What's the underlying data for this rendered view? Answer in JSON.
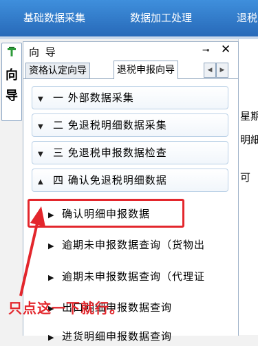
{
  "menubar": {
    "items": [
      "基础数据采集",
      "数据加工处理",
      "退税"
    ]
  },
  "vertical_tab": {
    "label_line1": "向",
    "label_line2": "导"
  },
  "panel": {
    "title": "向 导",
    "pin": "⊸",
    "close": "✕",
    "tabs": [
      "资格认定向导",
      "退税申报向导"
    ],
    "active_tab": "退税申报向导",
    "sections": [
      {
        "label": "一 外部数据采集",
        "chevron": "▼"
      },
      {
        "label": "二 免退税明细数据采集",
        "chevron": "▼"
      },
      {
        "label": "三 免退税申报数据检查",
        "chevron": "▼"
      },
      {
        "label": "四 确认免退税明细数据",
        "chevron": "▲"
      }
    ],
    "items": [
      {
        "label": "确认明细申报数据"
      },
      {
        "label": "逾期未申报数据查询（货物出"
      },
      {
        "label": "逾期未申报数据查询（代理证"
      },
      {
        "label": "出口明细申报数据查询"
      },
      {
        "label": "进货明细申报数据查询"
      }
    ]
  },
  "right_fragments": [
    "星期",
    "明細",
    "可"
  ],
  "annotation": "只点这一下就行。",
  "colors": {
    "menubar": "#2f7bd0",
    "highlight": "#e3262c",
    "annotation": "#e3262c"
  }
}
